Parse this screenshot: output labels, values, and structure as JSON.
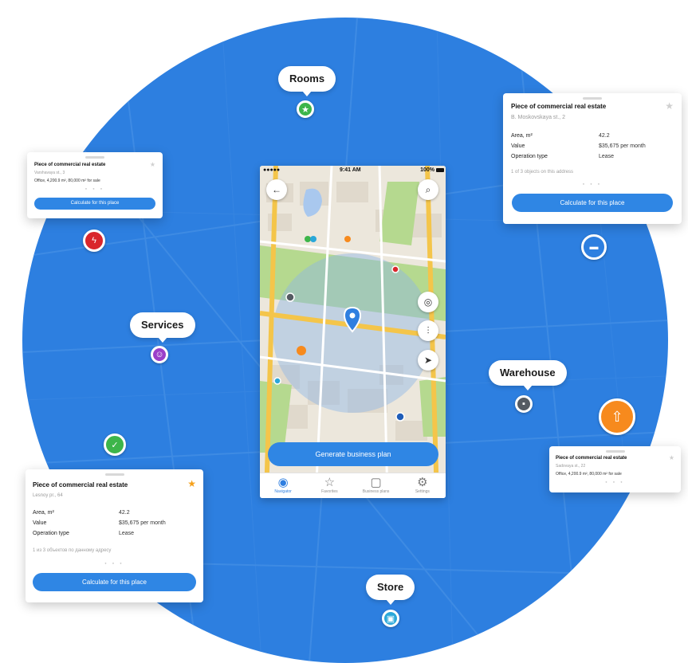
{
  "labels": {
    "rooms": "Rooms",
    "services": "Services",
    "warehouse": "Warehouse",
    "store": "Store"
  },
  "colors": {
    "background_circle": "#2d7fe0",
    "accent_blue": "#2f86e4",
    "pin_green": "#3db54a",
    "pin_red": "#d9262c",
    "pin_purple": "#9b3fc9",
    "pin_orange": "#f78a1d",
    "pin_gray": "#555b63",
    "pin_teal": "#2aa7d9",
    "star_orange": "#f5a01a"
  },
  "card_top_left": {
    "title": "Piece of commercial real estate",
    "address": "Varshavaya st., 3",
    "detail": "Office, 4,200.9 m², 80,000 m² for sale",
    "dots": "● ● ●",
    "button": "Calculate for this place"
  },
  "card_top_right": {
    "title": "Piece of commercial real estate",
    "address": "B. Moskovskaya st., 2",
    "rows": [
      {
        "key": "Area, m²",
        "value": "42.2"
      },
      {
        "key": "Value",
        "value": "$35,675 per month"
      },
      {
        "key": "Operation type",
        "value": "Lease"
      }
    ],
    "note": "1 of 3 objects on this address",
    "dots": "● ● ●",
    "button": "Calculate for this place"
  },
  "card_bottom_left": {
    "title": "Piece of commercial real estate",
    "address": "Lesnoy pr., 64",
    "rows": [
      {
        "key": "Area, m²",
        "value": "42.2"
      },
      {
        "key": "Value",
        "value": "$35,675 per month"
      },
      {
        "key": "Operation type",
        "value": "Lease"
      }
    ],
    "note": "1 из 3 объектов по данному адресу",
    "dots": "● ● ●",
    "button": "Calculate for this place"
  },
  "card_bottom_right": {
    "title": "Piece of commercial real estate",
    "address": "Sadovaya st., 22",
    "detail": "Office, 4,200.9 m², 80,000 m² for sale",
    "dots": "● ● ●"
  },
  "phone": {
    "status_left": "●●●●● ",
    "status_time": "9:41 AM",
    "status_right": "100%",
    "generate_button": "Generate business plan",
    "tabs": [
      {
        "label": "Navigator",
        "icon": "compass-icon"
      },
      {
        "label": "Favorites",
        "icon": "star-icon"
      },
      {
        "label": "Business plans",
        "icon": "folder-icon"
      },
      {
        "label": "Settings",
        "icon": "gear-icon"
      }
    ]
  }
}
